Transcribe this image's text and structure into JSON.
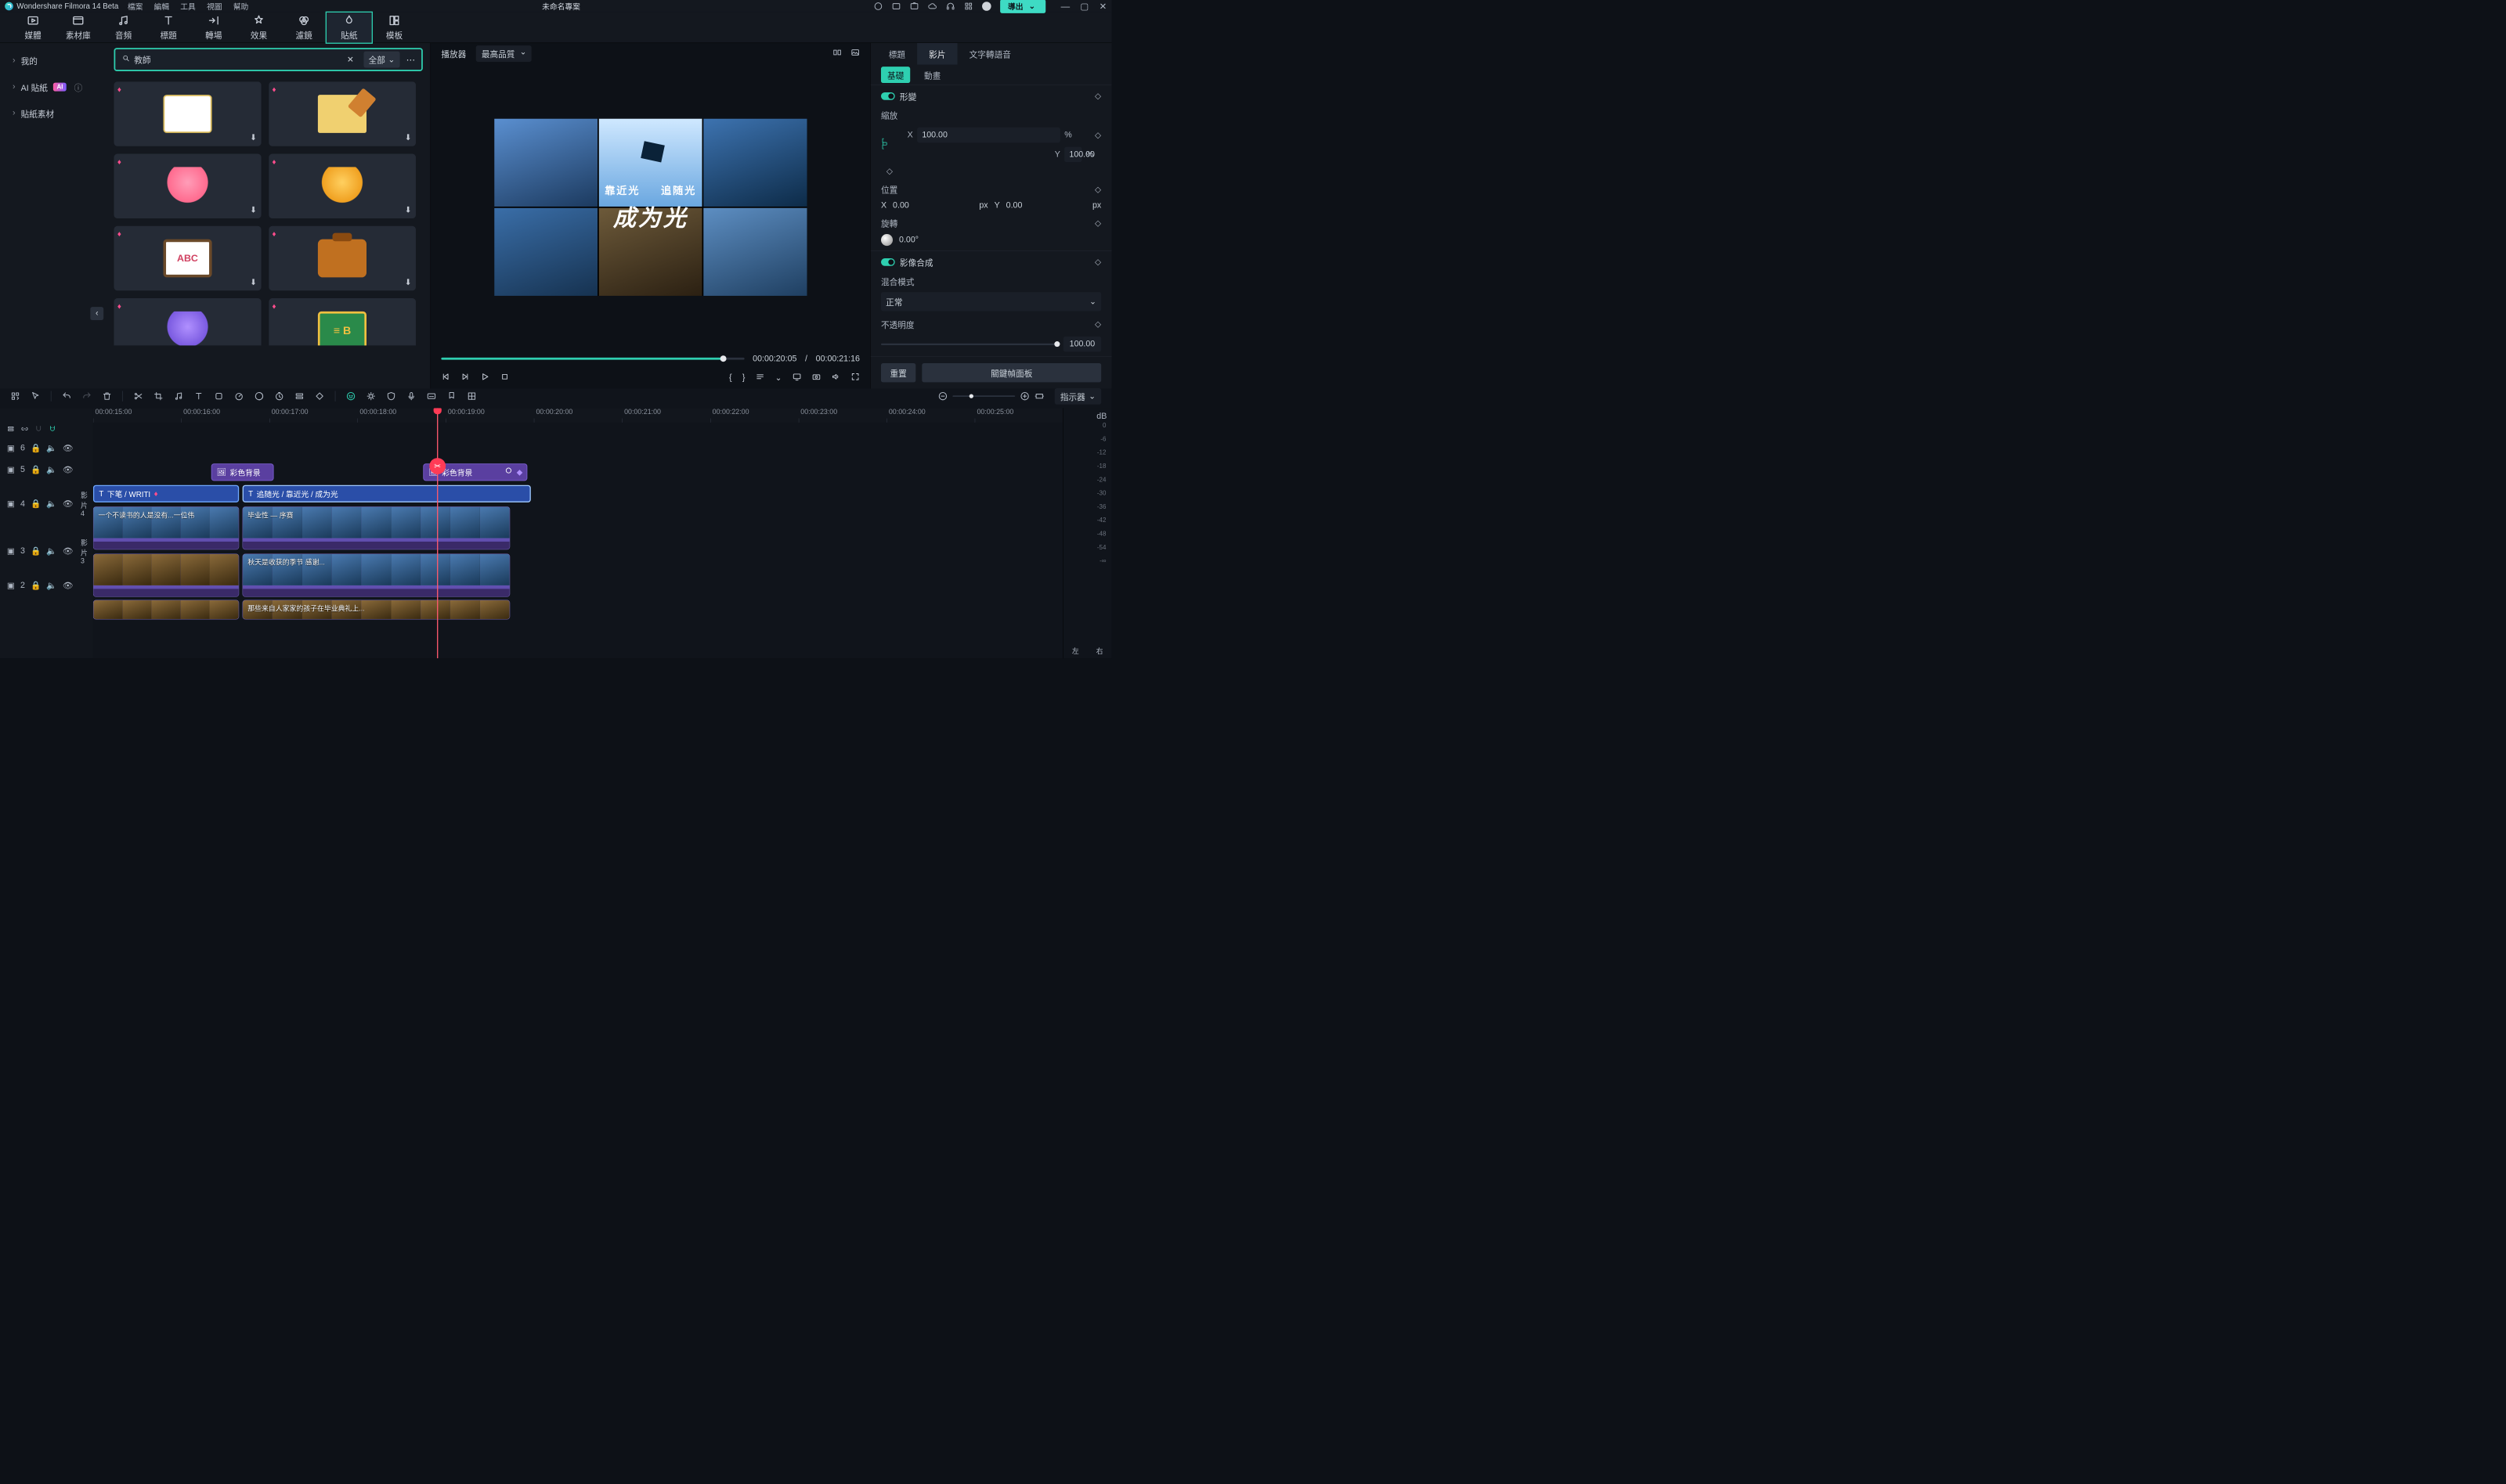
{
  "titlebar": {
    "product": "Wondershare Filmora 14 Beta",
    "menus": [
      "檔案",
      "編輯",
      "工具",
      "視圖",
      "幫助"
    ],
    "project": "未命名專案",
    "export": "導出"
  },
  "maintabs": [
    {
      "label": "媒體"
    },
    {
      "label": "素材庫"
    },
    {
      "label": "音頻"
    },
    {
      "label": "標題"
    },
    {
      "label": "轉場"
    },
    {
      "label": "效果"
    },
    {
      "label": "濾鏡"
    },
    {
      "label": "貼紙",
      "active": true
    },
    {
      "label": "模板"
    }
  ],
  "leftnav": {
    "items": [
      {
        "label": "我的"
      },
      {
        "label": "AI 貼紙",
        "ai": true
      },
      {
        "label": "貼紙素材"
      }
    ]
  },
  "search": {
    "value": "教師",
    "filter": "全部"
  },
  "preview": {
    "player_label": "播放器",
    "quality": "最高品質",
    "line1a": "靠近光",
    "line1b": "追随光",
    "line2": "成为光",
    "time_cur": "00:00:20:05",
    "time_sep": "/",
    "time_dur": "00:00:21:16"
  },
  "rightpanel": {
    "tabs": [
      "標題",
      "影片",
      "文字轉語音"
    ],
    "active": 1,
    "subtabs": [
      "基礎",
      "動畫"
    ],
    "sub_active": 0,
    "transform": "形變",
    "scale_label": "縮放",
    "scale_x_label": "X",
    "scale_x": "100.00",
    "scale_y_label": "Y",
    "scale_y": "100.00",
    "pct": "%",
    "position_label": "位置",
    "pos_x_label": "X",
    "pos_x": "0.00",
    "pos_y_label": "Y",
    "pos_y": "0.00",
    "px": "px",
    "rotate_label": "旋轉",
    "rotate": "0.00°",
    "composite": "影像合成",
    "blend_label": "混合模式",
    "blend_value": "正常",
    "opacity_label": "不透明度",
    "opacity": "100.00",
    "reset": "重置",
    "keyframe_btn": "關鍵幀面板"
  },
  "timeline": {
    "indicator": "指示器",
    "ticks": [
      "00:00:15:00",
      "00:00:16:00",
      "00:00:17:00",
      "00:00:18:00",
      "00:00:19:00",
      "00:00:20:00",
      "00:00:21:00",
      "00:00:22:00",
      "00:00:23:00",
      "00:00:24:00",
      "00:00:25:00"
    ],
    "tracks": {
      "t6": "6",
      "t5": "5",
      "t4": "4",
      "t4_name": "影片 4",
      "t3": "3",
      "t3_name": "影片 3",
      "t2": "2"
    },
    "clips": {
      "bg1": "彩色背景",
      "bg2": "彩色背景",
      "title1": "下笔 / WRITI",
      "title2": "追随光 / 靠近光 / 成为光",
      "v4a": "一个不读书的人是没有...一位伟",
      "v4b": "毕业性 — 序赛",
      "v3a": "",
      "v3b": "秋天是收获的季节 感谢...",
      "v2a": "",
      "v2b": "那些来自人家家的孩子在毕业典礼上..."
    },
    "meter": [
      "0",
      "-6",
      "-12",
      "-18",
      "-24",
      "-30",
      "-36",
      "-42",
      "-48",
      "-54",
      "-∞"
    ],
    "meter_l": "左",
    "meter_r": "右",
    "db": "dB"
  }
}
